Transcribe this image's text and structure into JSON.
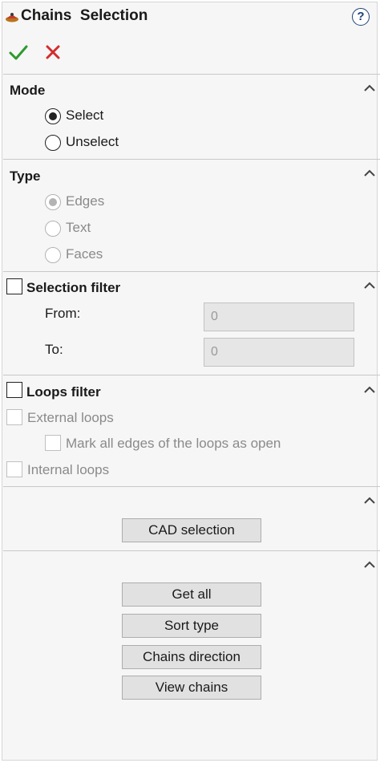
{
  "header": {
    "title": "Chains  Selection",
    "help_glyph": "?"
  },
  "icons": {
    "ok": "check-icon",
    "cancel": "close-icon",
    "help": "help-icon",
    "collapse": "chevron-up-icon",
    "logo": "app-logo-icon"
  },
  "colors": {
    "ok_green": "#2c9a2c",
    "cancel_red": "#d42d2d",
    "help_blue": "#1e3f78"
  },
  "mode": {
    "title": "Mode",
    "options": [
      {
        "label": "Select",
        "checked": true
      },
      {
        "label": "Unselect",
        "checked": false
      }
    ]
  },
  "type": {
    "title": "Type",
    "options": [
      {
        "label": "Edges",
        "checked": true
      },
      {
        "label": "Text",
        "checked": false
      },
      {
        "label": "Faces",
        "checked": false
      }
    ]
  },
  "selection_filter": {
    "title": "Selection filter",
    "from_label": "From:",
    "from_value": "0",
    "to_label": "To:",
    "to_value": "0"
  },
  "loops_filter": {
    "title": "Loops filter",
    "external_loops": "External loops",
    "mark_all_edges": "Mark all edges of the loops as open",
    "internal_loops": "Internal loops"
  },
  "cad": {
    "button": "CAD selection"
  },
  "actions": {
    "get_all": "Get all",
    "sort_type": "Sort type",
    "chains_direction": "Chains direction",
    "view_chains": "View chains"
  }
}
